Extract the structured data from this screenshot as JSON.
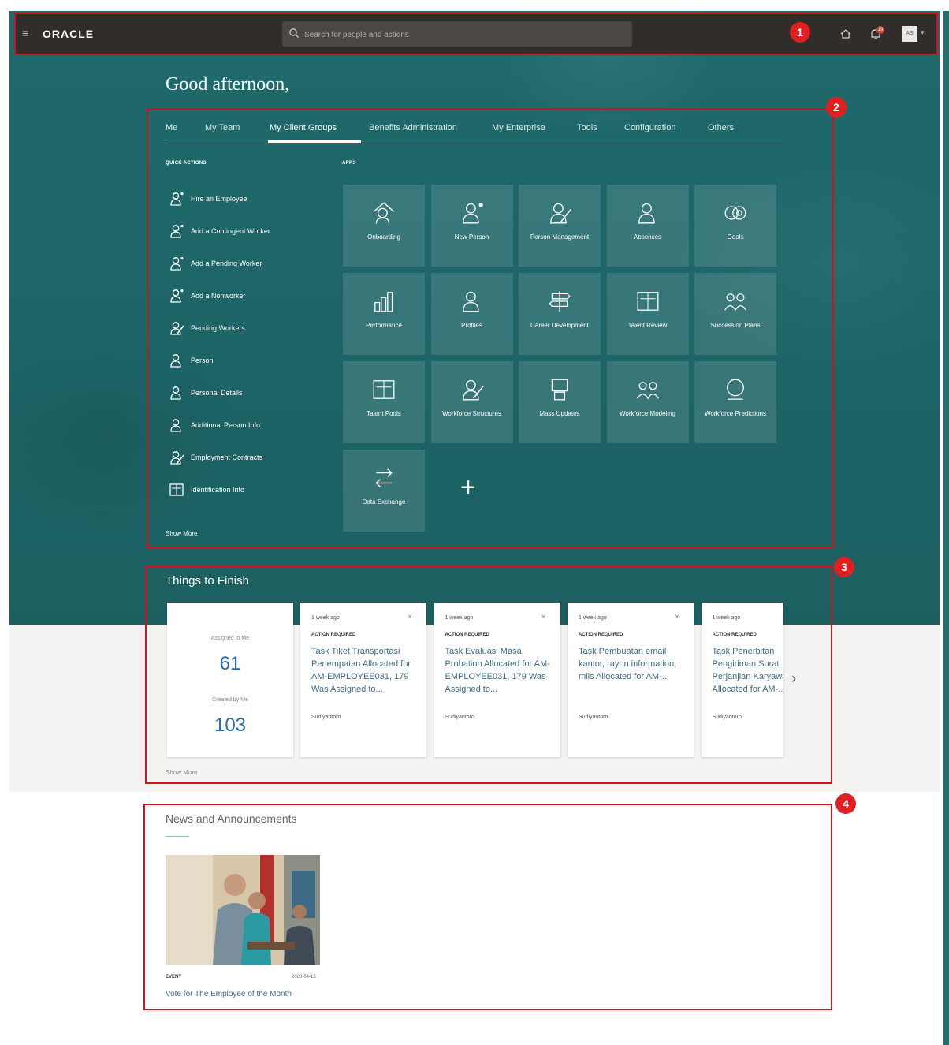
{
  "header": {
    "logo": "ORACLE",
    "search_placeholder": "Search for people and actions",
    "notification_count": "19",
    "avatar_initials": "AS"
  },
  "greeting": "Good afternoon,",
  "tabs": [
    "Me",
    "My Team",
    "My Client Groups",
    "Benefits Administration",
    "My Enterprise",
    "Tools",
    "Configuration",
    "Others"
  ],
  "active_tab": "My Client Groups",
  "quick_actions": {
    "heading": "QUICK ACTIONS",
    "items": [
      {
        "label": "Hire an Employee",
        "icon": "person-add-icon"
      },
      {
        "label": "Add a Contingent Worker",
        "icon": "person-add-icon"
      },
      {
        "label": "Add a Pending Worker",
        "icon": "person-add-icon"
      },
      {
        "label": "Add a Nonworker",
        "icon": "person-add-icon"
      },
      {
        "label": "Pending Workers",
        "icon": "person-edit-icon"
      },
      {
        "label": "Person",
        "icon": "person-icon"
      },
      {
        "label": "Personal Details",
        "icon": "person-icon"
      },
      {
        "label": "Additional Person Info",
        "icon": "person-icon"
      },
      {
        "label": "Employment Contracts",
        "icon": "person-edit-icon"
      },
      {
        "label": "Identification Info",
        "icon": "id-card-icon"
      }
    ],
    "show_more": "Show More"
  },
  "apps": {
    "heading": "APPS",
    "tiles": [
      {
        "label": "Onboarding",
        "icon": "onboarding-icon"
      },
      {
        "label": "New Person",
        "icon": "new-person-icon"
      },
      {
        "label": "Person Management",
        "icon": "person-management-icon"
      },
      {
        "label": "Absences",
        "icon": "absences-icon"
      },
      {
        "label": "Goals",
        "icon": "goals-icon"
      },
      {
        "label": "Performance",
        "icon": "performance-icon"
      },
      {
        "label": "Profiles",
        "icon": "profiles-icon"
      },
      {
        "label": "Career Development",
        "icon": "career-development-icon"
      },
      {
        "label": "Talent Review",
        "icon": "talent-review-icon"
      },
      {
        "label": "Succession Plans",
        "icon": "succession-plans-icon"
      },
      {
        "label": "Talent Pools",
        "icon": "talent-pools-icon"
      },
      {
        "label": "Workforce Structures",
        "icon": "workforce-structures-icon"
      },
      {
        "label": "Mass Updates",
        "icon": "mass-updates-icon"
      },
      {
        "label": "Workforce Modeling",
        "icon": "workforce-modeling-icon"
      },
      {
        "label": "Workforce Predictions",
        "icon": "workforce-predictions-icon"
      },
      {
        "label": "Data Exchange",
        "icon": "data-exchange-icon"
      }
    ],
    "add_symbol": "+"
  },
  "things_to_finish": {
    "title": "Things to Finish",
    "assigned_label": "Assigned to Me",
    "assigned_count": "61",
    "created_label": "Created by Me",
    "created_count": "103",
    "cards": [
      {
        "time": "1 week ago",
        "status": "ACTION REQUIRED",
        "text": "Task Tiket Transportasi Penempatan Allocated for AM-EMPLOYEE031, 179 Was Assigned to...",
        "owner": "Sudiyantoro"
      },
      {
        "time": "1 week ago",
        "status": "ACTION REQUIRED",
        "text": "Task Evaluasi Masa Probation Allocated for AM-EMPLOYEE031, 179 Was Assigned to...",
        "owner": "Sudiyantoro"
      },
      {
        "time": "1 week ago",
        "status": "ACTION REQUIRED",
        "text": "Task Pembuatan email kantor, rayon information, mils Allocated for AM-...",
        "owner": "Sudiyantoro"
      },
      {
        "time": "1 week ago",
        "status": "ACTION REQUIRED",
        "text": "Task Penerbitan Pengiriman Surat Perjanjian Karyawan Allocated for AM-...",
        "owner": "Sudiyantoro"
      }
    ],
    "show_more": "Show More"
  },
  "news": {
    "title": "News and Announcements",
    "items": [
      {
        "category": "EVENT",
        "date": "2023-04-13",
        "headline": "Vote for The Employee of the Month"
      }
    ]
  },
  "callouts": [
    "1",
    "2",
    "3",
    "4"
  ],
  "colors": {
    "teal": "#1f6a6c",
    "header": "#312d2a",
    "callout": "#e02020",
    "link": "#3f6b8e"
  }
}
